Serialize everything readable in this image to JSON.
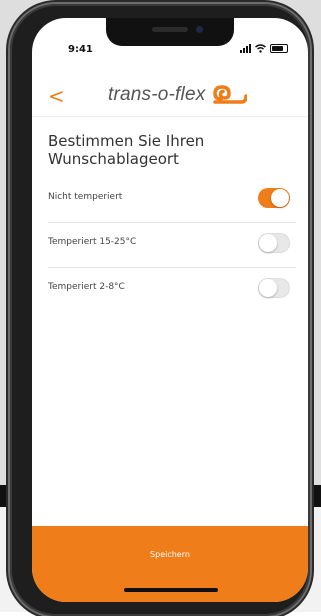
{
  "status_bar": {
    "time": "9:41"
  },
  "header": {
    "back_glyph": "<",
    "brand": "trans-o-flex",
    "brand_color": "#ee7d1a"
  },
  "page": {
    "title": "Bestimmen Sie Ihren Wunschablageort"
  },
  "options": [
    {
      "label": "Nicht temperiert",
      "enabled": true
    },
    {
      "label": "Temperiert 15-25°C",
      "enabled": false
    },
    {
      "label": "Temperiert 2-8°C",
      "enabled": false
    }
  ],
  "footer": {
    "save_label": "Speichern"
  },
  "colors": {
    "accent": "#ee7d1a",
    "toggle_off": "#e8e8e8"
  },
  "icons": [
    "chevron-left-icon",
    "brand-logo-icon",
    "signal-icon",
    "wifi-icon",
    "battery-icon"
  ]
}
